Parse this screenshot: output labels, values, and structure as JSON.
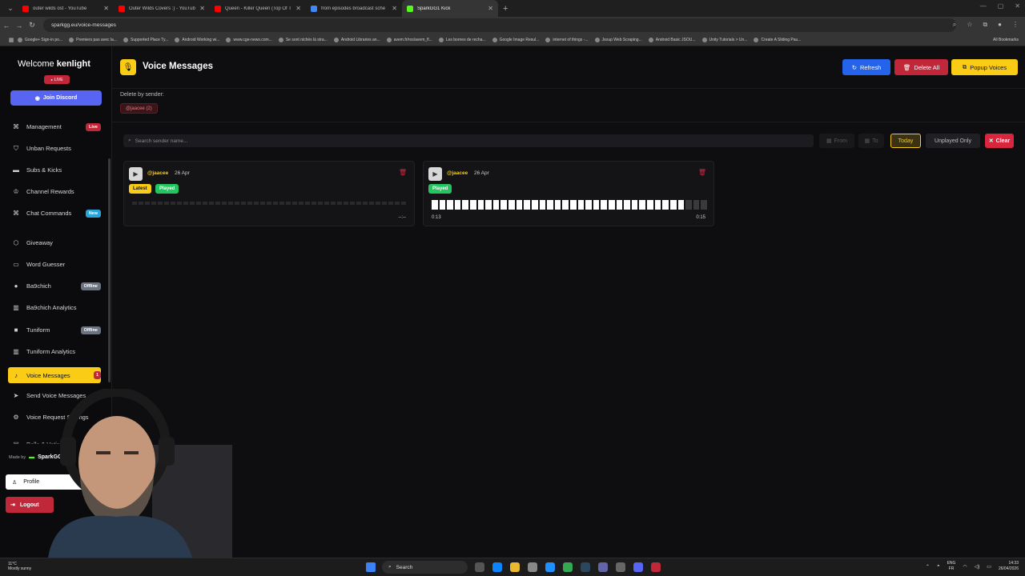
{
  "browser": {
    "tabs": [
      {
        "title": "outer wilds ost - YouTube",
        "color": "#ff0000"
      },
      {
        "title": "Outer Wilds Covers :) - YouTub",
        "color": "#ff0000"
      },
      {
        "title": "Queen - Killer Queen (Top Of T",
        "color": "#ff0000"
      },
      {
        "title": "from episodes broadcast sche",
        "color": "#4285f4"
      },
      {
        "title": "SparkGG1 Kick",
        "color": "#53fc18",
        "active": true
      }
    ],
    "url": "sparkgg.eu/voice-messages",
    "bookmarks": [
      "Google+ Sign-in po...",
      "Premiers pas avec la...",
      "Supported Place Ty...",
      "Android Working wi...",
      "www.cge-news.com...",
      "Se sont nichés là stra...",
      "Android Libraries an...",
      "avem.fr/ros/avem_fl...",
      "Les bornes de recha...",
      "Google Image Resul...",
      "internet of things -...",
      "Jsoup Web Scraping...",
      "Android Basic JSOU...",
      "Unity Tutorials > Un...",
      "Create A Sliding Pau..."
    ],
    "all_bookmarks": "All Bookmarks"
  },
  "sidebar": {
    "welcome_prefix": "Welcome",
    "username": "kenlight",
    "live_badge": "LIVE",
    "discord_button": "Join Discord",
    "items": [
      {
        "label": "Management",
        "icon": "⌘",
        "badge": "Live",
        "badge_type": "b-live"
      },
      {
        "label": "Unban Requests",
        "icon": "⛉"
      },
      {
        "label": "Subs & Kicks",
        "icon": "▬"
      },
      {
        "label": "Channel Rewards",
        "icon": "♔"
      },
      {
        "label": "Chat Commands",
        "icon": "⌘",
        "badge": "New",
        "badge_type": "b-new"
      },
      {
        "label": "Giveaway",
        "icon": "⬡"
      },
      {
        "label": "Word Guesser",
        "icon": "▭"
      },
      {
        "label": "Ba9chich",
        "icon": "●",
        "badge": "Offline",
        "badge_type": "b-off"
      },
      {
        "label": "Ba9chich Analytics",
        "icon": "▥"
      },
      {
        "label": "Tuniform",
        "icon": "■",
        "badge": "Offline",
        "badge_type": "b-off"
      },
      {
        "label": "Tuniform Analytics",
        "icon": "▥"
      },
      {
        "label": "Voice Messages",
        "icon": "♪",
        "badge": "1",
        "badge_type": "b-count",
        "active": true
      },
      {
        "label": "Send Voice Messages",
        "icon": "➤"
      },
      {
        "label": "Voice Request Settings",
        "icon": "⚙"
      },
      {
        "label": "Polls & Voting",
        "icon": "▤"
      }
    ],
    "made_by_prefix": "Made by",
    "made_by_name": "SparkGG1",
    "profile_label": "Profile",
    "logout_label": "Logout"
  },
  "main": {
    "title": "Voice Messages",
    "refresh_label": "Refresh",
    "delete_all_label": "Delete All",
    "popup_label": "Popup Voices",
    "delete_by_sender_label": "Delete by sender:",
    "sender_chip": "@jaacee (2)",
    "search_placeholder": "Search sender name...",
    "from_label": "From",
    "to_label": "To",
    "today_label": "Today",
    "unplayed_label": "Unplayed Only",
    "clear_label": "Clear",
    "cards": [
      {
        "sender": "@jaacee",
        "date": "26 Apr",
        "tags": [
          "Latest",
          "Played"
        ],
        "time_right": "--:--",
        "progress": 0
      },
      {
        "sender": "@jaacee",
        "date": "26 Apr",
        "tags": [
          "Played"
        ],
        "time_left": "0:13",
        "time_right": "0:15",
        "progress": 0.9
      }
    ]
  },
  "taskbar": {
    "weather_temp": "11°C",
    "weather_desc": "Mostly sunny",
    "search": "Search",
    "lang_top": "ENG",
    "lang_bottom": "FR",
    "time": "14:33",
    "date": "26/04/2026"
  }
}
